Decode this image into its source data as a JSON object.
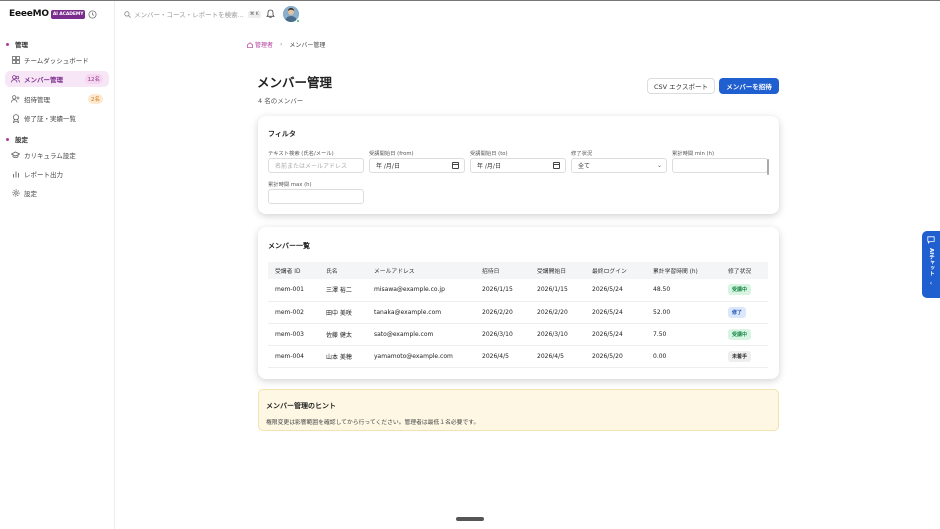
{
  "brand": {
    "name": "EeeeMO",
    "badge": "AI ACADEMY"
  },
  "search": {
    "placeholder": "メンバー・コース・レポートを検索...",
    "shortcut": "⌘ K"
  },
  "sidebar": {
    "section_admin": "管理",
    "section_settings": "設定",
    "items": [
      {
        "label": "チームダッシュボード",
        "icon": "grid-icon"
      },
      {
        "label": "メンバー管理",
        "icon": "users-icon",
        "count": "12名",
        "active": true
      },
      {
        "label": "招待管理",
        "icon": "user-plus-icon",
        "count": "2名"
      },
      {
        "label": "修了証・実績一覧",
        "icon": "award-icon"
      },
      {
        "label": "カリキュラム設定",
        "icon": "graduation-cap-icon"
      },
      {
        "label": "レポート出力",
        "icon": "bar-chart-icon"
      },
      {
        "label": "設定",
        "icon": "gear-icon"
      }
    ]
  },
  "breadcrumb": {
    "home": "管理者",
    "current": "メンバー管理"
  },
  "page": {
    "title": "メンバー管理",
    "member_count": "4 名のメンバー"
  },
  "actions": {
    "csv_export": "CSV エクスポート",
    "invite": "メンバーを招待"
  },
  "filters": {
    "title": "フィルタ",
    "text_search_label": "テキスト検索 (氏名/メール)",
    "text_search_placeholder": "名前またはメールアドレス",
    "start_from_label": "受講開始日 (from)",
    "start_from_value": "年 /月/日",
    "start_to_label": "受講開始日 (to)",
    "start_to_value": "年 /月/日",
    "completion_label": "修了状況",
    "completion_value": "全て",
    "hours_min_label": "累計時間 min (h)",
    "hours_max_label": "累計時間 max (h)"
  },
  "members": {
    "title": "メンバー一覧",
    "headers": [
      "受講者 ID",
      "氏名",
      "メールアドレス",
      "招待日",
      "受講開始日",
      "最終ログイン",
      "累計学習時間 (h)",
      "修了状況"
    ],
    "rows": [
      {
        "id": "mem-001",
        "name": "三澤 裕二",
        "email": "misawa@example.co.jp",
        "invited": "2026/1/15",
        "started": "2026/1/15",
        "last_login": "2026/5/24",
        "hours": "48.50",
        "status": "受講中"
      },
      {
        "id": "mem-002",
        "name": "田中 美咲",
        "email": "tanaka@example.com",
        "invited": "2026/2/20",
        "started": "2026/2/20",
        "last_login": "2026/5/24",
        "hours": "52.00",
        "status": "修了"
      },
      {
        "id": "mem-003",
        "name": "佐藤 健太",
        "email": "sato@example.com",
        "invited": "2026/3/10",
        "started": "2026/3/10",
        "last_login": "2026/5/24",
        "hours": "7.50",
        "status": "受講中"
      },
      {
        "id": "mem-004",
        "name": "山本 美穂",
        "email": "yamamoto@example.com",
        "invited": "2026/4/5",
        "started": "2026/4/5",
        "last_login": "2026/5/20",
        "hours": "0.00",
        "status": "未着手"
      }
    ]
  },
  "hint": {
    "title": "メンバー管理のヒント",
    "text": "権限変更は影響範囲を確認してから行ってください。管理者は最低１名必要です。"
  },
  "ai_chat": {
    "label": "AIチャット"
  },
  "colors": {
    "accent": "#1f5fd0",
    "brand": "#7b2d8e",
    "active_bg": "#f7e6f6"
  }
}
